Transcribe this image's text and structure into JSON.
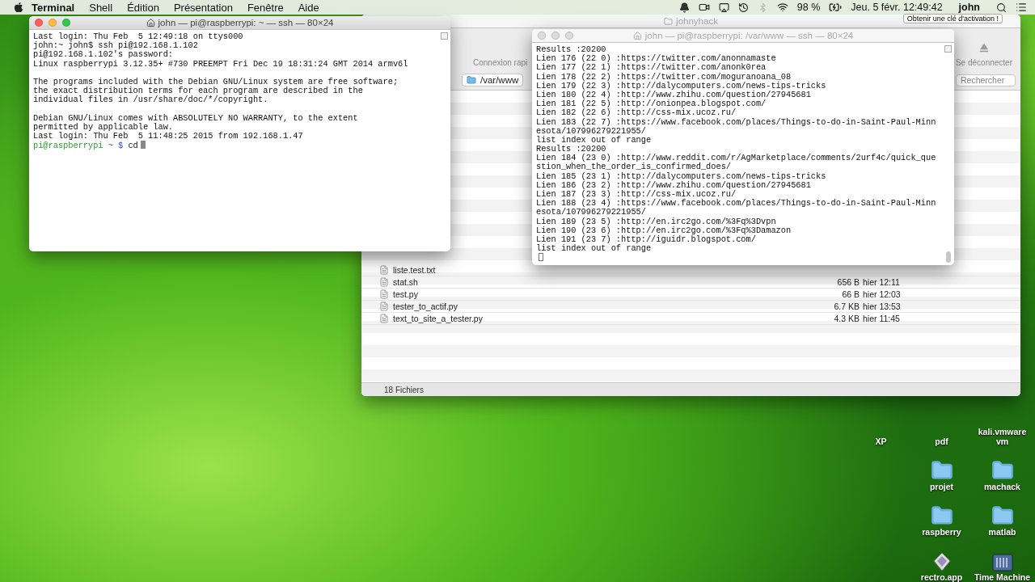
{
  "menu_bar": {
    "app": "Terminal",
    "items": [
      "Shell",
      "Édition",
      "Présentation",
      "Fenêtre",
      "Aide"
    ],
    "battery": "98 %",
    "clock": "Jeu. 5 févr. 12:49:42",
    "user": "john"
  },
  "notification": "Obtenir une clé d'activation !",
  "finder": {
    "title": "johnyhack",
    "toolbar": [
      {
        "label": "Connexion rapi",
        "kind": "text"
      },
      {
        "label": "Se déconnecter",
        "kind": "eject"
      }
    ],
    "path": "/var/www",
    "search": {
      "placeholder": "Rechercher"
    },
    "files": [
      {
        "name": "liste.test.txt"
      },
      {
        "name": "stat.sh",
        "size": "656 B",
        "date": "hier 12:11"
      },
      {
        "name": "test.py",
        "size": "66 B",
        "date": "hier 12:03"
      },
      {
        "name": "tester_to_actif.py",
        "size": "6.7 KB",
        "date": "hier 13:53"
      },
      {
        "name": "text_to_site_a_tester.py",
        "size": "4.3 KB",
        "date": "hier 11:45"
      }
    ],
    "status": "18 Fichiers"
  },
  "terminals": [
    {
      "title": "john — pi@raspberrypi: ~ — ssh — 80×24",
      "active": true,
      "lines": [
        {
          "kind": "text",
          "text": "Last login: Thu Feb  5 12:49:18 on ttys000"
        },
        {
          "kind": "text",
          "text": "john:~ john$ ssh pi@192.168.1.102"
        },
        {
          "kind": "text",
          "text": "pi@192.168.1.102's password:"
        },
        {
          "kind": "text",
          "text": "Linux raspberrypi 3.12.35+ #730 PREEMPT Fri Dec 19 18:31:24 GMT 2014 armv6l"
        },
        {
          "kind": "blank"
        },
        {
          "kind": "text",
          "text": "The programs included with the Debian GNU/Linux system are free software;"
        },
        {
          "kind": "text",
          "text": "the exact distribution terms for each program are described in the"
        },
        {
          "kind": "text",
          "text": "individual files in /usr/share/doc/*/copyright."
        },
        {
          "kind": "blank"
        },
        {
          "kind": "text",
          "text": "Debian GNU/Linux comes with ABSOLUTELY NO WARRANTY, to the extent"
        },
        {
          "kind": "text",
          "text": "permitted by applicable law."
        },
        {
          "kind": "text",
          "text": "Last login: Thu Feb  5 11:48:25 2015 from 192.168.1.47"
        },
        {
          "kind": "prompt",
          "user": "pi@raspberrypi",
          "path": "~ $",
          "text": "cd"
        }
      ]
    },
    {
      "title": "john — pi@raspberrypi: /var/www — ssh — 80×24",
      "active": false,
      "lines": [
        {
          "kind": "text",
          "text": "Results :20200"
        },
        {
          "kind": "text",
          "text": "Lien 176 (22 0) :https://twitter.com/anonnamaste"
        },
        {
          "kind": "text",
          "text": "Lien 177 (22 1) :https://twitter.com/anonk0rea"
        },
        {
          "kind": "text",
          "text": "Lien 178 (22 2) :https://twitter.com/moguranoana_08"
        },
        {
          "kind": "text",
          "text": "Lien 179 (22 3) :http://dalycomputers.com/news-tips-tricks"
        },
        {
          "kind": "text",
          "text": "Lien 180 (22 4) :http://www.zhihu.com/question/27945681"
        },
        {
          "kind": "text",
          "text": "Lien 181 (22 5) :http://onionpea.blogspot.com/"
        },
        {
          "kind": "text",
          "text": "Lien 182 (22 6) :http://css-mix.ucoz.ru/"
        },
        {
          "kind": "text",
          "text": "Lien 183 (22 7) :https://www.facebook.com/places/Things-to-do-in-Saint-Paul-Minn"
        },
        {
          "kind": "text",
          "text": "esota/107996279221955/"
        },
        {
          "kind": "text",
          "text": "list index out of range"
        },
        {
          "kind": "text",
          "text": "Results :20200"
        },
        {
          "kind": "text",
          "text": "Lien 184 (23 0) :http://www.reddit.com/r/AgMarketplace/comments/2urf4c/quick_que"
        },
        {
          "kind": "text",
          "text": "stion_when_the_order_is_confirmed_does/"
        },
        {
          "kind": "text",
          "text": "Lien 185 (23 1) :http://dalycomputers.com/news-tips-tricks"
        },
        {
          "kind": "text",
          "text": "Lien 186 (23 2) :http://www.zhihu.com/question/27945681"
        },
        {
          "kind": "text",
          "text": "Lien 187 (23 3) :http://css-mix.ucoz.ru/"
        },
        {
          "kind": "text",
          "text": "Lien 188 (23 4) :https://www.facebook.com/places/Things-to-do-in-Saint-Paul-Minn"
        },
        {
          "kind": "text",
          "text": "esota/107996279221955/"
        },
        {
          "kind": "text",
          "text": "Lien 189 (23 5) :http://en.irc2go.com/%3Fq%3Dvpn"
        },
        {
          "kind": "text",
          "text": "Lien 190 (23 6) :http://en.irc2go.com/%3Fq%3Damazon"
        },
        {
          "kind": "text",
          "text": "Lien 191 (23 7) :http://iguidr.blogspot.com/"
        },
        {
          "kind": "text",
          "text": "list index out of range"
        },
        {
          "kind": "cursor"
        }
      ]
    }
  ],
  "desktop_icons": [
    {
      "label": "XP",
      "kind": "covered"
    },
    {
      "label": "pdf",
      "kind": "covered"
    },
    {
      "label": "kali.vmware vm",
      "kind": "covered"
    },
    {
      "label": "projet",
      "kind": "folder"
    },
    {
      "label": "machack",
      "kind": "folder"
    },
    {
      "label": "raspberry",
      "kind": "folder"
    },
    {
      "label": "matlab",
      "kind": "folder"
    },
    {
      "label": "rectro.app",
      "kind": "app"
    },
    {
      "label": "Time Machine",
      "kind": "disk"
    }
  ]
}
